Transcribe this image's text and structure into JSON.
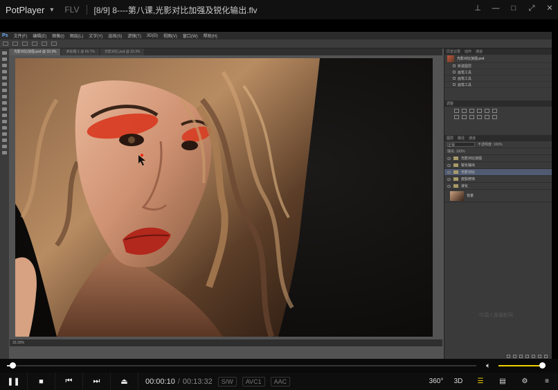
{
  "player": {
    "app_name": "PotPlayer",
    "format": "FLV",
    "video_title": "[8/9] 8----第八课,光影对比加强及锐化输出.flv",
    "time_current": "00:00:10",
    "time_separator": "/",
    "time_total": "00:13:32",
    "badges": [
      "S/W",
      "AVC1",
      "AAC"
    ],
    "playback_progress": 0.012,
    "volume_level": 0.96,
    "right_labels": {
      "deg": "360°",
      "threed": "3D"
    },
    "accent_color": "#f0d000"
  },
  "photoshop": {
    "logo": "Ps",
    "menu_items": [
      "文件(F)",
      "编辑(E)",
      "图像(I)",
      "图层(L)",
      "文字(Y)",
      "选择(S)",
      "滤镜(T)",
      "3D(D)",
      "视图(V)",
      "窗口(W)",
      "帮助(H)"
    ],
    "doc_tabs": [
      "光影对比加强.psd @ 33.3%",
      "未标题-1 @ 66.7%",
      "光影对比.psd @ 33.3%"
    ],
    "status_zoom": "33.33%",
    "history_header": [
      "历史记录",
      "动作",
      "通道"
    ],
    "history_snapshot": "光影对比加强.psd",
    "history_items": [
      "新建图层",
      "画笔工具",
      "画笔工具",
      "画笔工具"
    ],
    "adjustments_header": "调整",
    "layers_header": [
      "图层",
      "路径",
      "通道"
    ],
    "blend_mode": "正常",
    "opacity": "不透明度: 100%",
    "fill": "填充: 100%",
    "layers": [
      {
        "name": "光影对比加强",
        "selected": false
      },
      {
        "name": "锐化输出",
        "selected": false
      },
      {
        "name": "光影对比",
        "selected": true
      },
      {
        "name": "皮肤修饰",
        "selected": false
      },
      {
        "name": "液化",
        "selected": false
      }
    ],
    "background_layer": "背景",
    "watermark": "中国人像摄影网"
  }
}
